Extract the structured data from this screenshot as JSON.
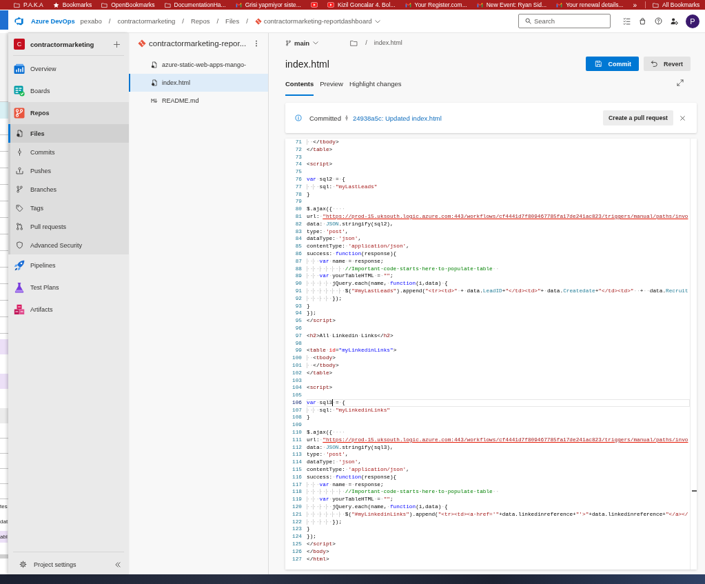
{
  "bookmarks_bar": {
    "items": [
      {
        "kind": "folder",
        "label": "P.A.K.A"
      },
      {
        "kind": "star",
        "label": "Bookmarks"
      },
      {
        "kind": "folder",
        "label": "OpenBookmarks"
      },
      {
        "kind": "folder",
        "label": "DocumentationHa..."
      },
      {
        "kind": "mail",
        "label": "Grisi yapmiyor siste..."
      },
      {
        "kind": "video"
      },
      {
        "kind": "video",
        "label": "Kizil Goncalar 4. Bol..."
      },
      {
        "kind": "mail",
        "label": "Your Register.com..."
      },
      {
        "kind": "mail",
        "label": "New Event: Ryan Sid..."
      },
      {
        "kind": "mail",
        "label": "Your renewal details..."
      }
    ],
    "overflow": "»",
    "all_bookmarks": "All Bookmarks"
  },
  "header": {
    "product": "Azure DevOps",
    "breadcrumbs": [
      {
        "kind": "link",
        "text": "pexabo"
      },
      {
        "kind": "separator",
        "text": "/"
      },
      {
        "kind": "link",
        "text": "contractormarketing"
      },
      {
        "kind": "separator",
        "text": "/"
      },
      {
        "kind": "link",
        "text": "Repos"
      },
      {
        "kind": "separator",
        "text": "/"
      },
      {
        "kind": "link",
        "text": "Files"
      },
      {
        "kind": "separator",
        "text": "/"
      },
      {
        "kind": "repo",
        "text": "contractormarketing-reportdashboard"
      }
    ],
    "search": {
      "placeholder": "Search"
    },
    "avatar": "P"
  },
  "background_window": {
    "texts": [
      "tes",
      "dat",
      "abl"
    ]
  },
  "sidebar": {
    "project": {
      "initial": "C",
      "name": "contractormarketing"
    },
    "items": [
      {
        "kind": "overview",
        "label": "Overview",
        "selected": false,
        "expanded": false
      },
      {
        "kind": "boards",
        "label": "Boards",
        "selected": false,
        "expanded": false
      },
      {
        "kind": "repos",
        "label": "Repos",
        "selected": true,
        "expanded": true,
        "children": [
          {
            "kind": "files",
            "label": "Files",
            "selected": true
          },
          {
            "kind": "commits",
            "label": "Commits",
            "selected": false
          },
          {
            "kind": "pushes",
            "label": "Pushes",
            "selected": false
          },
          {
            "kind": "branches",
            "label": "Branches",
            "selected": false
          },
          {
            "kind": "tags",
            "label": "Tags",
            "selected": false
          },
          {
            "kind": "pullrequests",
            "label": "Pull requests",
            "selected": false
          },
          {
            "kind": "security",
            "label": "Advanced Security",
            "selected": false
          }
        ]
      },
      {
        "kind": "pipelines",
        "label": "Pipelines",
        "selected": false,
        "expanded": false
      },
      {
        "kind": "testplans",
        "label": "Test Plans",
        "selected": false,
        "expanded": false
      },
      {
        "kind": "artifacts",
        "label": "Artifacts",
        "selected": false,
        "expanded": false
      }
    ],
    "footer": {
      "label": "Project settings"
    }
  },
  "file_tree": {
    "repo": "contractormarketing-repor...",
    "items": [
      {
        "kind": "config",
        "name": "azure-static-web-apps-mango-",
        "selected": false
      },
      {
        "kind": "html",
        "name": "index.html",
        "selected": true
      },
      {
        "kind": "markdown",
        "name": "README.md",
        "selected": false
      }
    ]
  },
  "content": {
    "branch": "main",
    "path": [
      {
        "kind": "separator",
        "text": "/"
      },
      {
        "kind": "file",
        "text": "index.html"
      }
    ],
    "title": "index.html",
    "actions": [
      {
        "kind": "primary",
        "label": "Commit"
      },
      {
        "kind": "secondary",
        "label": "Revert"
      }
    ],
    "tabs": [
      {
        "label": "Contents",
        "selected": true
      },
      {
        "label": "Preview",
        "selected": false
      },
      {
        "label": "Highlight changes",
        "selected": false
      }
    ],
    "banner": {
      "status": "Committed",
      "link": "24938a5c: Updated index.html",
      "action": "Create a pull request"
    },
    "editor": {
      "lines": [
        {
          "number": "71",
          "current": false,
          "tokens": [
            {
              "kind": "ind",
              "text": "··"
            },
            {
              "kind": "pl",
              "text": "</"
            },
            {
              "kind": "tag",
              "text": "tbody"
            },
            {
              "kind": "pl",
              "text": ">"
            }
          ]
        },
        {
          "number": "72",
          "current": false,
          "tokens": [
            {
              "kind": "pl",
              "text": "</"
            },
            {
              "kind": "tag",
              "text": "table"
            },
            {
              "kind": "pl",
              "text": ">"
            }
          ]
        },
        {
          "number": "73",
          "current": false
        },
        {
          "number": "74",
          "current": false,
          "tokens": [
            {
              "kind": "pl",
              "text": "<"
            },
            {
              "kind": "tag",
              "text": "script"
            },
            {
              "kind": "pl",
              "text": ">"
            }
          ]
        },
        {
          "number": "75",
          "current": false
        },
        {
          "number": "76",
          "current": false,
          "tokens": [
            {
              "kind": "kw",
              "text": "var"
            },
            {
              "kind": "ws",
              "text": "·"
            },
            {
              "kind": "pl",
              "text": "sql2"
            },
            {
              "kind": "ws",
              "text": "·"
            },
            {
              "kind": "pl",
              "text": "="
            },
            {
              "kind": "ws",
              "text": "·"
            },
            {
              "kind": "pl",
              "text": "{"
            }
          ]
        },
        {
          "number": "77",
          "current": false,
          "tokens": [
            {
              "kind": "ind",
              "text": "····"
            },
            {
              "kind": "pl",
              "text": "sql:"
            },
            {
              "kind": "ws",
              "text": "·"
            },
            {
              "kind": "str",
              "text": "\"myLastLeads\""
            }
          ]
        },
        {
          "number": "78",
          "current": false,
          "tokens": [
            {
              "kind": "pl",
              "text": "}"
            }
          ]
        },
        {
          "number": "79",
          "current": false
        },
        {
          "number": "80",
          "current": false,
          "tokens": [
            {
              "kind": "pl",
              "text": "$.ajax({"
            },
            {
              "kind": "ws",
              "text": "····"
            }
          ]
        },
        {
          "number": "81",
          "current": false,
          "tokens": [
            {
              "kind": "pl",
              "text": "url:"
            },
            {
              "kind": "ws",
              "text": "·"
            },
            {
              "kind": "url",
              "text": "\"https://prod-15.uksouth.logic.azure.com:443/workflows/cf4441d7f809467785fa17de241ac823/triggers/manual/paths/invo"
            }
          ]
        },
        {
          "number": "82",
          "current": false,
          "tokens": [
            {
              "kind": "pl",
              "text": "data:"
            },
            {
              "kind": "ws",
              "text": "·"
            },
            {
              "kind": "type",
              "text": "JSON"
            },
            {
              "kind": "pl",
              "text": ".stringify(sql2),"
            }
          ]
        },
        {
          "number": "83",
          "current": false,
          "tokens": [
            {
              "kind": "pl",
              "text": "type:"
            },
            {
              "kind": "ws",
              "text": "·"
            },
            {
              "kind": "str",
              "text": "'post'"
            },
            {
              "kind": "pl",
              "text": ","
            }
          ]
        },
        {
          "number": "84",
          "current": false,
          "tokens": [
            {
              "kind": "pl",
              "text": "dataType:"
            },
            {
              "kind": "ws",
              "text": "·"
            },
            {
              "kind": "str",
              "text": "'json'"
            },
            {
              "kind": "pl",
              "text": ","
            }
          ]
        },
        {
          "number": "85",
          "current": false,
          "tokens": [
            {
              "kind": "pl",
              "text": "contentType:"
            },
            {
              "kind": "ws",
              "text": "·"
            },
            {
              "kind": "str",
              "text": "'application/json'"
            },
            {
              "kind": "pl",
              "text": ","
            }
          ]
        },
        {
          "number": "86",
          "current": false,
          "tokens": [
            {
              "kind": "pl",
              "text": "success:"
            },
            {
              "kind": "ws",
              "text": "·"
            },
            {
              "kind": "kw",
              "text": "function"
            },
            {
              "kind": "pl",
              "text": "(response){"
            }
          ]
        },
        {
          "number": "87",
          "current": false,
          "tokens": [
            {
              "kind": "ind",
              "text": "····"
            },
            {
              "kind": "kw",
              "text": "var"
            },
            {
              "kind": "ws",
              "text": "·"
            },
            {
              "kind": "pl",
              "text": "name"
            },
            {
              "kind": "ws",
              "text": "·"
            },
            {
              "kind": "pl",
              "text": "="
            },
            {
              "kind": "ws",
              "text": "·"
            },
            {
              "kind": "pl",
              "text": "response;"
            }
          ]
        },
        {
          "number": "88",
          "current": false,
          "tokens": [
            {
              "kind": "ind",
              "text": "············"
            },
            {
              "kind": "com",
              "text": "//Important·code·starts·here·to·populate·table"
            },
            {
              "kind": "ws",
              "text": "··"
            }
          ]
        },
        {
          "number": "89",
          "current": false,
          "tokens": [
            {
              "kind": "ind",
              "text": "····"
            },
            {
              "kind": "kw",
              "text": "var"
            },
            {
              "kind": "ws",
              "text": "·"
            },
            {
              "kind": "pl",
              "text": "yourTableHTML"
            },
            {
              "kind": "ws",
              "text": "·"
            },
            {
              "kind": "pl",
              "text": "="
            },
            {
              "kind": "ws",
              "text": "·"
            },
            {
              "kind": "str",
              "text": "\"\""
            },
            {
              "kind": "pl",
              "text": ";"
            }
          ]
        },
        {
          "number": "90",
          "current": false,
          "tokens": [
            {
              "kind": "ind",
              "text": "········"
            },
            {
              "kind": "pl",
              "text": "jQuery.each(name,"
            },
            {
              "kind": "ws",
              "text": "·"
            },
            {
              "kind": "kw",
              "text": "function"
            },
            {
              "kind": "pl",
              "text": "(i,data)"
            },
            {
              "kind": "ws",
              "text": "·"
            },
            {
              "kind": "pl",
              "text": "{"
            }
          ]
        },
        {
          "number": "91",
          "current": false,
          "tokens": [
            {
              "kind": "ind",
              "text": "············"
            },
            {
              "kind": "pl",
              "text": "$("
            },
            {
              "kind": "str",
              "text": "\"#myLastLeads\""
            },
            {
              "kind": "pl",
              "text": ").append("
            },
            {
              "kind": "str",
              "text": "\"<tr><td>\""
            },
            {
              "kind": "ws",
              "text": "·"
            },
            {
              "kind": "pl",
              "text": "+"
            },
            {
              "kind": "ws",
              "text": "·"
            },
            {
              "kind": "pl",
              "text": "data."
            },
            {
              "kind": "type",
              "text": "LeadID"
            },
            {
              "kind": "pl",
              "text": "+"
            },
            {
              "kind": "str",
              "text": "\"</td><td>\""
            },
            {
              "kind": "pl",
              "text": "+"
            },
            {
              "kind": "ws",
              "text": "·"
            },
            {
              "kind": "pl",
              "text": "data."
            },
            {
              "kind": "type",
              "text": "Createdate"
            },
            {
              "kind": "pl",
              "text": "+"
            },
            {
              "kind": "str",
              "text": "\"</td><td>\""
            },
            {
              "kind": "ws",
              "text": "··"
            },
            {
              "kind": "pl",
              "text": "+"
            },
            {
              "kind": "ws",
              "text": "··"
            },
            {
              "kind": "pl",
              "text": "data."
            },
            {
              "kind": "type",
              "text": "Recruit"
            }
          ]
        },
        {
          "number": "92",
          "current": false,
          "tokens": [
            {
              "kind": "ind",
              "text": "········"
            },
            {
              "kind": "pl",
              "text": "});"
            }
          ]
        },
        {
          "number": "93",
          "current": false,
          "tokens": [
            {
              "kind": "pl",
              "text": "}"
            }
          ]
        },
        {
          "number": "94",
          "current": false,
          "tokens": [
            {
              "kind": "pl",
              "text": "});"
            }
          ]
        },
        {
          "number": "95",
          "current": false,
          "tokens": [
            {
              "kind": "pl",
              "text": "</"
            },
            {
              "kind": "tag",
              "text": "script"
            },
            {
              "kind": "pl",
              "text": ">"
            }
          ]
        },
        {
          "number": "96",
          "current": false
        },
        {
          "number": "97",
          "current": false,
          "tokens": [
            {
              "kind": "pl",
              "text": "<"
            },
            {
              "kind": "tag",
              "text": "h2"
            },
            {
              "kind": "pl",
              "text": ">All"
            },
            {
              "kind": "ws",
              "text": "·"
            },
            {
              "kind": "pl",
              "text": "Linkedin"
            },
            {
              "kind": "ws",
              "text": "·"
            },
            {
              "kind": "pl",
              "text": "Links</"
            },
            {
              "kind": "tag",
              "text": "h2"
            },
            {
              "kind": "pl",
              "text": ">"
            }
          ]
        },
        {
          "number": "98",
          "current": false
        },
        {
          "number": "99",
          "current": false,
          "tokens": [
            {
              "kind": "pl",
              "text": "<"
            },
            {
              "kind": "tag",
              "text": "table"
            },
            {
              "kind": "ws",
              "text": "·"
            },
            {
              "kind": "attr",
              "text": "id"
            },
            {
              "kind": "pl",
              "text": "="
            },
            {
              "kind": "val",
              "text": "\"myLinkedinLinks\""
            },
            {
              "kind": "pl",
              "text": ">"
            }
          ]
        },
        {
          "number": "100",
          "current": false,
          "tokens": [
            {
              "kind": "ind",
              "text": "··"
            },
            {
              "kind": "pl",
              "text": "<"
            },
            {
              "kind": "tag",
              "text": "tbody"
            },
            {
              "kind": "pl",
              "text": ">"
            }
          ]
        },
        {
          "number": "101",
          "current": false,
          "tokens": [
            {
              "kind": "ind",
              "text": "··"
            },
            {
              "kind": "pl",
              "text": "</"
            },
            {
              "kind": "tag",
              "text": "tbody"
            },
            {
              "kind": "pl",
              "text": ">"
            }
          ]
        },
        {
          "number": "102",
          "current": false,
          "tokens": [
            {
              "kind": "pl",
              "text": "</"
            },
            {
              "kind": "tag",
              "text": "table"
            },
            {
              "kind": "pl",
              "text": ">"
            }
          ]
        },
        {
          "number": "103",
          "current": false
        },
        {
          "number": "104",
          "current": false,
          "tokens": [
            {
              "kind": "pl",
              "text": "<"
            },
            {
              "kind": "tag",
              "text": "script"
            },
            {
              "kind": "pl",
              "text": ">"
            }
          ]
        },
        {
          "number": "105",
          "current": false
        },
        {
          "number": "106",
          "current": true,
          "tokens": [
            {
              "kind": "kw",
              "text": "var"
            },
            {
              "kind": "ws",
              "text": "·"
            },
            {
              "kind": "pl",
              "text": "sql3"
            },
            {
              "kind": "cursor"
            },
            {
              "kind": "ws",
              "text": "·"
            },
            {
              "kind": "pl",
              "text": "="
            },
            {
              "kind": "ws",
              "text": "·"
            },
            {
              "kind": "pl",
              "text": "{"
            }
          ]
        },
        {
          "number": "107",
          "current": false,
          "tokens": [
            {
              "kind": "ind",
              "text": "····"
            },
            {
              "kind": "pl",
              "text": "sql:"
            },
            {
              "kind": "ws",
              "text": "·"
            },
            {
              "kind": "str",
              "text": "\"myLinkedinLinks\""
            }
          ]
        },
        {
          "number": "108",
          "current": false,
          "tokens": [
            {
              "kind": "pl",
              "text": "}"
            }
          ]
        },
        {
          "number": "109",
          "current": false
        },
        {
          "number": "110",
          "current": false,
          "tokens": [
            {
              "kind": "pl",
              "text": "$.ajax({"
            },
            {
              "kind": "ws",
              "text": "····"
            }
          ]
        },
        {
          "number": "111",
          "current": false,
          "tokens": [
            {
              "kind": "pl",
              "text": "url:"
            },
            {
              "kind": "ws",
              "text": "·"
            },
            {
              "kind": "url",
              "text": "\"https://prod-15.uksouth.logic.azure.com:443/workflows/cf4441d7f809467785fa17de241ac823/triggers/manual/paths/invo"
            }
          ]
        },
        {
          "number": "112",
          "current": false,
          "tokens": [
            {
              "kind": "pl",
              "text": "data:"
            },
            {
              "kind": "ws",
              "text": "·"
            },
            {
              "kind": "type",
              "text": "JSON"
            },
            {
              "kind": "pl",
              "text": ".stringify(sql3),"
            }
          ]
        },
        {
          "number": "113",
          "current": false,
          "tokens": [
            {
              "kind": "pl",
              "text": "type:"
            },
            {
              "kind": "ws",
              "text": "·"
            },
            {
              "kind": "str",
              "text": "'post'"
            },
            {
              "kind": "pl",
              "text": ","
            }
          ]
        },
        {
          "number": "114",
          "current": false,
          "tokens": [
            {
              "kind": "pl",
              "text": "dataType:"
            },
            {
              "kind": "ws",
              "text": "·"
            },
            {
              "kind": "str",
              "text": "'json'"
            },
            {
              "kind": "pl",
              "text": ","
            }
          ]
        },
        {
          "number": "115",
          "current": false,
          "tokens": [
            {
              "kind": "pl",
              "text": "contentType:"
            },
            {
              "kind": "ws",
              "text": "·"
            },
            {
              "kind": "str",
              "text": "'application/json'"
            },
            {
              "kind": "pl",
              "text": ","
            }
          ]
        },
        {
          "number": "116",
          "current": false,
          "tokens": [
            {
              "kind": "pl",
              "text": "success:"
            },
            {
              "kind": "ws",
              "text": "·"
            },
            {
              "kind": "kw",
              "text": "function"
            },
            {
              "kind": "pl",
              "text": "(response){"
            }
          ]
        },
        {
          "number": "117",
          "current": false,
          "tokens": [
            {
              "kind": "ind",
              "text": "····"
            },
            {
              "kind": "kw",
              "text": "var"
            },
            {
              "kind": "ws",
              "text": "·"
            },
            {
              "kind": "pl",
              "text": "name"
            },
            {
              "kind": "ws",
              "text": "·"
            },
            {
              "kind": "pl",
              "text": "="
            },
            {
              "kind": "ws",
              "text": "·"
            },
            {
              "kind": "pl",
              "text": "response;"
            }
          ]
        },
        {
          "number": "118",
          "current": false,
          "tokens": [
            {
              "kind": "ind",
              "text": "············"
            },
            {
              "kind": "com",
              "text": "//Important·code·starts·here·to·populate·table"
            },
            {
              "kind": "ws",
              "text": "··"
            }
          ]
        },
        {
          "number": "119",
          "current": false,
          "tokens": [
            {
              "kind": "ind",
              "text": "····"
            },
            {
              "kind": "kw",
              "text": "var"
            },
            {
              "kind": "ws",
              "text": "·"
            },
            {
              "kind": "pl",
              "text": "yourTableHTML"
            },
            {
              "kind": "ws",
              "text": "·"
            },
            {
              "kind": "pl",
              "text": "="
            },
            {
              "kind": "ws",
              "text": "·"
            },
            {
              "kind": "str",
              "text": "\"\""
            },
            {
              "kind": "pl",
              "text": ";"
            }
          ]
        },
        {
          "number": "120",
          "current": false,
          "tokens": [
            {
              "kind": "ind",
              "text": "········"
            },
            {
              "kind": "pl",
              "text": "jQuery.each(name,"
            },
            {
              "kind": "ws",
              "text": "·"
            },
            {
              "kind": "kw",
              "text": "function"
            },
            {
              "kind": "pl",
              "text": "(i,data)"
            },
            {
              "kind": "ws",
              "text": "·"
            },
            {
              "kind": "pl",
              "text": "{"
            }
          ]
        },
        {
          "number": "121",
          "current": false,
          "tokens": [
            {
              "kind": "ind",
              "text": "············"
            },
            {
              "kind": "pl",
              "text": "$("
            },
            {
              "kind": "str",
              "text": "\"#myLinkedinLinks\""
            },
            {
              "kind": "pl",
              "text": ").append("
            },
            {
              "kind": "str",
              "text": "\"<tr><td><a·href='\""
            },
            {
              "kind": "pl",
              "text": "+data.linkedinreference+"
            },
            {
              "kind": "str",
              "text": "\"'>\""
            },
            {
              "kind": "pl",
              "text": "+data.linkedinreference+"
            },
            {
              "kind": "str",
              "text": "\"</a></"
            }
          ]
        },
        {
          "number": "122",
          "current": false,
          "tokens": [
            {
              "kind": "ind",
              "text": "········"
            },
            {
              "kind": "pl",
              "text": "});"
            }
          ]
        },
        {
          "number": "123",
          "current": false,
          "tokens": [
            {
              "kind": "pl",
              "text": "}"
            }
          ]
        },
        {
          "number": "124",
          "current": false,
          "tokens": [
            {
              "kind": "pl",
              "text": "});"
            }
          ]
        },
        {
          "number": "125",
          "current": false,
          "tokens": [
            {
              "kind": "pl",
              "text": "</"
            },
            {
              "kind": "tag",
              "text": "script"
            },
            {
              "kind": "pl",
              "text": ">"
            }
          ]
        },
        {
          "number": "126",
          "current": false,
          "tokens": [
            {
              "kind": "pl",
              "text": "</"
            },
            {
              "kind": "tag",
              "text": "body"
            },
            {
              "kind": "pl",
              "text": ">"
            }
          ]
        },
        {
          "number": "127",
          "current": false,
          "tokens": [
            {
              "kind": "pl",
              "text": "</"
            },
            {
              "kind": "tag",
              "text": "html"
            },
            {
              "kind": "pl",
              "text": ">"
            }
          ]
        }
      ]
    }
  }
}
